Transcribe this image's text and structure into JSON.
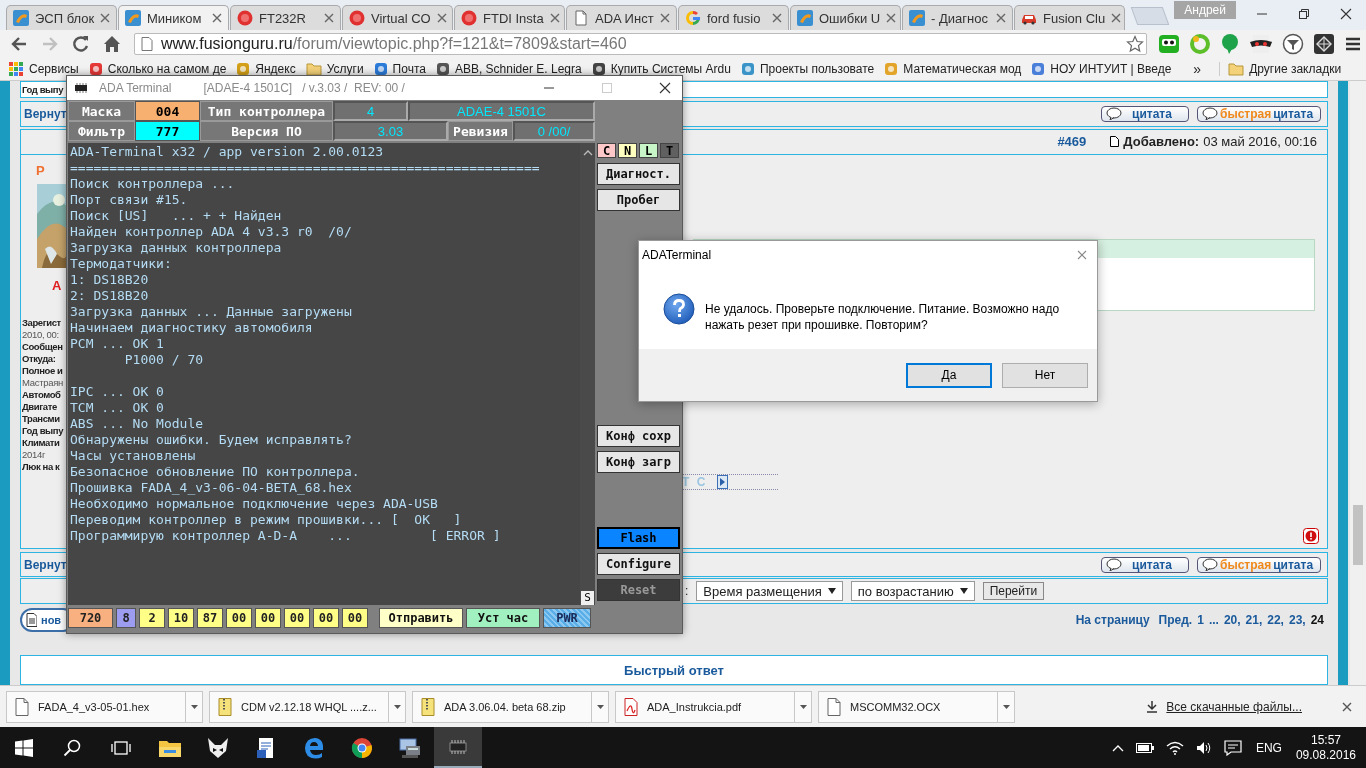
{
  "browser": {
    "tabs": [
      {
        "title": "ЭСП блок",
        "kind": "forum",
        "selected": false
      },
      {
        "title": "Миником",
        "kind": "forum",
        "selected": true
      },
      {
        "title": "FT232R",
        "kind": "ftdi",
        "selected": false
      },
      {
        "title": "Virtual CO",
        "kind": "ftdi",
        "selected": false
      },
      {
        "title": "FTDI Insta",
        "kind": "ftdi",
        "selected": false
      },
      {
        "title": "ADA Инст",
        "kind": "document",
        "selected": false
      },
      {
        "title": "ford fusio",
        "kind": "google",
        "selected": false
      },
      {
        "title": "Ошибки U",
        "kind": "forum",
        "selected": false
      },
      {
        "title": "- Диагнос",
        "kind": "forum",
        "selected": false
      },
      {
        "title": "Fusion Clu",
        "kind": "car",
        "selected": false
      }
    ],
    "user": "Андрей",
    "nav": [
      {
        "kind": "back",
        "disabled": false
      },
      {
        "kind": "forward",
        "disabled": true
      },
      {
        "kind": "reload",
        "disabled": false
      },
      {
        "kind": "home",
        "disabled": false
      }
    ],
    "address": {
      "host": "www.fusionguru.ru",
      "path": "/forum/viewtopic.php?f=121&t=7809&start=460"
    },
    "bookmarks": [
      {
        "label": "Сервисы",
        "kind": "apps"
      },
      {
        "label": "Сколько на самом де",
        "kind": "site"
      },
      {
        "label": "Яндекс",
        "kind": "site"
      },
      {
        "label": "Услуги",
        "kind": "folder"
      },
      {
        "label": "Почта",
        "kind": "site"
      },
      {
        "label": "ABB, Schnider E. Legra",
        "kind": "site"
      },
      {
        "label": "Купить Системы Ardu",
        "kind": "site"
      },
      {
        "label": "Проекты пользовате",
        "kind": "site"
      },
      {
        "label": "Математическая мод",
        "kind": "site"
      },
      {
        "label": "НОУ ИНТУИТ | Введе",
        "kind": "site"
      }
    ],
    "more": "»",
    "other": "Другие закладки"
  },
  "forum": {
    "top_row": "Год выпу",
    "top_actions": {
      "back_link": "Вернут",
      "quote": "цитата",
      "quick_accent": "быстрая",
      "quick_label": "цитата"
    },
    "post": {
      "number": "#469",
      "added_label": "Добавлено:",
      "added_date": "03 май 2016, 00:16",
      "author": "Р",
      "rank": "А",
      "profile": [
        {
          "text": "Зарегист",
          "bold": true
        },
        {
          "text": "2010, 00:",
          "bold": false
        },
        {
          "text": "Сообщен",
          "bold": true
        },
        {
          "text": "Откуда:",
          "bold": true
        },
        {
          "text": "Полное и",
          "bold": true
        },
        {
          "text": "Мастраян",
          "bold": false
        },
        {
          "text": "Автомоб",
          "bold": true
        },
        {
          "text": "Двигате",
          "bold": true
        },
        {
          "text": "Трансми",
          "bold": true
        },
        {
          "text": "Год выпу",
          "bold": true
        },
        {
          "text": "Климати",
          "bold": true
        },
        {
          "text": "2014г",
          "bold": false
        },
        {
          "text": "Люк на к",
          "bold": true
        }
      ],
      "spoiler": "T C"
    },
    "bottom_actions": {
      "back_link": "Вернут",
      "quote": "цитата",
      "quick_accent": "быстрая",
      "quick_label": "цитата"
    },
    "sort": {
      "separator": ":",
      "fields": [
        {
          "value": "Время размещения"
        },
        {
          "value": "по возрастанию"
        }
      ],
      "button": "Перейти"
    },
    "new_topic": "нов",
    "pagination": {
      "label": "На страницу",
      "items": [
        {
          "text": "Пред.",
          "selected": false
        },
        {
          "text": "1",
          "selected": false
        },
        {
          "text": "...",
          "selected": false
        },
        {
          "text": "20,",
          "selected": false
        },
        {
          "text": "21,",
          "selected": false
        },
        {
          "text": "22,",
          "selected": false
        },
        {
          "text": "23,",
          "selected": false
        },
        {
          "text": "24",
          "selected": true
        }
      ]
    },
    "quick_reply": "Быстрый ответ"
  },
  "terminal": {
    "title": "ADA Terminal",
    "model_title": "[ADAE-4 1501C]",
    "version_title": "/ v.3.03 /  REV: 00 /",
    "header": {
      "mask_label": "Маска",
      "mask": "004",
      "type_label": "Тип контроллера",
      "type": "4",
      "model": "ADAE-4 1501C",
      "filter_label": "Фильтр",
      "filter": "777",
      "version_label": "Версия ПО",
      "version": "3.03",
      "revision_label": "Ревизия",
      "revision": "0 /00/"
    },
    "blocks": [
      [
        "ADA-Terminal x32 / app version 2.00.0123",
        "============================================================",
        "Поиск контроллера ...",
        "Порт связи #15.",
        "Поиск [US]   ... + + Найден",
        "Найден контроллер ADA 4 v3.3 r0  /0/",
        "Загрузка данных контроллера",
        "Термодатчики:",
        "1: DS18B20",
        "2: DS18B20",
        "Загрузка данных ... Данные загружены",
        "Начинаем диагностику автомобиля",
        "PCM ... OK 1",
        "       P1000 / 70"
      ],
      [
        "IPC ... OK 0",
        "TCM ... OK 0",
        "ABS ... No Module",
        "Обнаружены ошибки. Будем исправлять?",
        "Часы установлены",
        "Безопасное обновление ПО контроллера.",
        "Прошивка FADA_4_v3-06-04-BETA_68.hex",
        "Необходимо нормальное подключение через ADA-USB",
        "Переводим контроллер в режим прошивки... [  OK   ]",
        "Программирую контроллер A-D-A    ...          [ ERROR ]"
      ]
    ],
    "scroll_button": "S",
    "flags": [
      {
        "label": "C",
        "color": "#ffc8c8"
      },
      {
        "label": "N",
        "color": "#ffffc0"
      },
      {
        "label": "L",
        "color": "#c8f5c8"
      },
      {
        "label": "T",
        "color": "#606060"
      }
    ],
    "side_groups": [
      [
        {
          "label": "Диагност.",
          "kind": "normal"
        },
        {
          "label": "Пробег",
          "kind": "normal"
        }
      ],
      [
        {
          "label": "Конф сохр",
          "kind": "normal"
        },
        {
          "label": "Конф загр",
          "kind": "normal"
        }
      ],
      [
        {
          "label": "Flash",
          "kind": "primary"
        },
        {
          "label": "Configure",
          "kind": "normal"
        },
        {
          "label": "Reset",
          "kind": "dark"
        }
      ]
    ],
    "cells": [
      {
        "value": "720",
        "color": "#f8b080"
      },
      {
        "value": "8",
        "color": "#9c9cf0"
      },
      {
        "value": "2",
        "color": "#ffff88"
      },
      {
        "value": "10",
        "color": "#ffff88"
      },
      {
        "value": "87",
        "color": "#ffff88"
      },
      {
        "value": "00",
        "color": "#ffff88"
      },
      {
        "value": "00",
        "color": "#ffff88"
      },
      {
        "value": "00",
        "color": "#ffff88"
      },
      {
        "value": "00",
        "color": "#ffff88"
      },
      {
        "value": "00",
        "color": "#ffff88"
      }
    ],
    "actions": [
      {
        "label": "Отправить",
        "kind": "send"
      },
      {
        "label": "Уст час",
        "kind": "clock"
      },
      {
        "label": "PWR",
        "kind": "power"
      }
    ]
  },
  "dialog": {
    "title": "ADATerminal",
    "message": "Не удалось. Проверьте подключение. Питание. Возможно надо нажать резет при прошивке. Повторим?",
    "buttons": [
      {
        "label": "Да",
        "focused": true
      },
      {
        "label": "Нет",
        "focused": false
      }
    ]
  },
  "downloads": {
    "items": [
      {
        "name": "FADA_4_v3-05-01.hex",
        "kind": "file"
      },
      {
        "name": "CDM v2.12.18 WHQL ....z...",
        "kind": "zip"
      },
      {
        "name": "ADA 3.06.04. beta 68.zip",
        "kind": "zip"
      },
      {
        "name": "ADA_Instrukcia.pdf",
        "kind": "pdf"
      },
      {
        "name": "MSCOMM32.OCX",
        "kind": "file"
      }
    ],
    "show_all": "Все скачанные файлы..."
  },
  "taskbar": {
    "apps": [
      {
        "kind": "folder",
        "active": false
      },
      {
        "kind": "mask",
        "active": false
      },
      {
        "kind": "document",
        "active": false
      },
      {
        "kind": "edge",
        "active": false
      },
      {
        "kind": "chrome",
        "active": false
      },
      {
        "kind": "computer",
        "active": false
      },
      {
        "kind": "chip",
        "active": true
      }
    ],
    "language": "ENG",
    "time": "15:57",
    "date": "09.08.2016"
  }
}
